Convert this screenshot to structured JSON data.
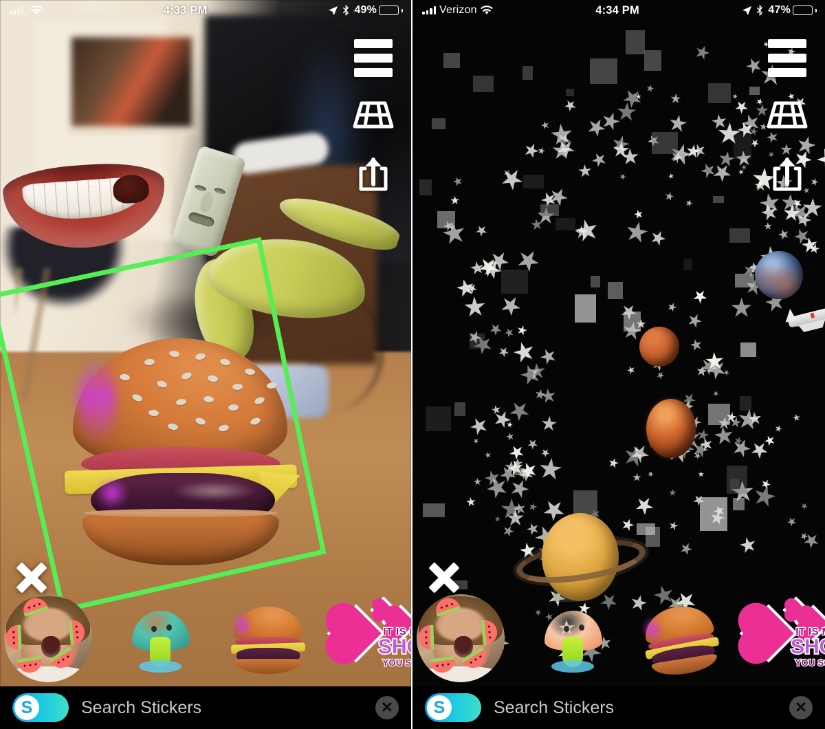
{
  "panels": [
    {
      "id": "left",
      "status": {
        "carrier": "",
        "signal_icon": "cellular-signal-icon",
        "wifi_icon": "wifi-icon",
        "time": "4:33 PM",
        "location_icon": "location-arrow-icon",
        "bluetooth_icon": "bluetooth-icon",
        "battery_percent": "49%",
        "battery_level": 49
      },
      "controls": [
        {
          "name": "menu-button",
          "icon": "hamburger-menu-icon",
          "label": "Menu"
        },
        {
          "name": "surface-grid-button",
          "icon": "perspective-grid-icon",
          "label": "Place on surface"
        },
        {
          "name": "share-button",
          "icon": "share-upload-icon",
          "label": "Share"
        }
      ],
      "close_label": "Close",
      "scene": {
        "type": "camera-ar",
        "description": "Living room camera view with wooden floor",
        "selection_box_color": "#55ee55",
        "ar_objects": [
          {
            "name": "mouth-sticker",
            "label": "3D Mouth"
          },
          {
            "name": "banana-sticker",
            "label": "3D Banana"
          },
          {
            "name": "face-bar-sticker",
            "label": "Face"
          },
          {
            "name": "burger-sticker",
            "label": "3D Cheeseburger",
            "selected": true
          }
        ]
      },
      "tray": [
        {
          "name": "sticker-avatar",
          "label": "Watermelon Face"
        },
        {
          "name": "sticker-mushroom",
          "label": "Mushroom",
          "cap_color": "#4fc4b2",
          "stem_color": "#c6f03a"
        },
        {
          "name": "sticker-burger",
          "label": "Cheeseburger"
        },
        {
          "name": "sticker-love",
          "label": "It Is Monday Showing You Some Love"
        }
      ],
      "search": {
        "brand_letter": "S",
        "brand_icon": "skype-logo-icon",
        "placeholder": "Search Stickers",
        "value": "",
        "clear_icon": "clear-x-icon"
      }
    },
    {
      "id": "right",
      "status": {
        "carrier": "Verizon",
        "signal_icon": "cellular-signal-icon",
        "wifi_icon": "wifi-icon",
        "time": "4:34 PM",
        "location_icon": "location-arrow-icon",
        "bluetooth_icon": "bluetooth-icon",
        "battery_percent": "47%",
        "battery_level": 47
      },
      "controls": [
        {
          "name": "menu-button",
          "icon": "hamburger-menu-icon",
          "label": "Menu"
        },
        {
          "name": "surface-grid-button",
          "icon": "perspective-grid-icon",
          "label": "Place on surface"
        },
        {
          "name": "share-button",
          "icon": "share-upload-icon",
          "label": "Share"
        }
      ],
      "close_label": "Close",
      "scene": {
        "type": "space-ar",
        "description": "Dark space scene with stars and planets",
        "ar_objects": [
          {
            "name": "star-field",
            "label": "Stars"
          },
          {
            "name": "planet-earth",
            "label": "Earth"
          },
          {
            "name": "space-shuttle",
            "label": "Space Shuttle"
          },
          {
            "name": "planet-mars-upper",
            "label": "Mars"
          },
          {
            "name": "planet-mars-lower",
            "label": "Mars"
          },
          {
            "name": "planet-saturn",
            "label": "Saturn"
          }
        ]
      },
      "tray": [
        {
          "name": "sticker-avatar",
          "label": "Watermelon Face"
        },
        {
          "name": "sticker-mushroom",
          "label": "Mushroom",
          "cap_color": "#f6c9a8",
          "stem_color": "#c6f03a"
        },
        {
          "name": "sticker-burger",
          "label": "Cheeseburger"
        },
        {
          "name": "sticker-love",
          "label": "It Is Monday Showing You Some Love"
        }
      ],
      "search": {
        "brand_letter": "S",
        "brand_icon": "skype-logo-icon",
        "placeholder": "Search Stickers",
        "value": "",
        "clear_icon": "clear-x-icon"
      }
    }
  ],
  "love_sticker": {
    "line1": "IT IS MONDAY!",
    "line2": "SHOWING",
    "line3": "YOU SOME LOVE"
  }
}
